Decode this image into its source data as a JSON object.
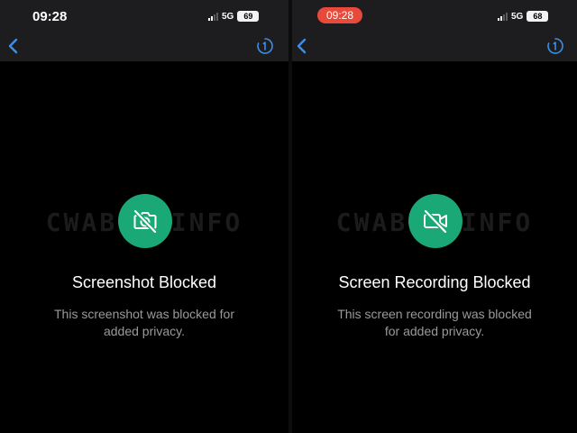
{
  "left": {
    "status": {
      "time": "09:28",
      "network": "5G",
      "battery": "69"
    },
    "watermark": "CWABETAINFO",
    "title": "Screenshot Blocked",
    "description": [
      "This screenshot was blocked for",
      "added privacy."
    ],
    "icons": {
      "back": "chevron-left-icon",
      "timer": "disappearing-timer-icon",
      "badge": "camera-off-icon"
    }
  },
  "right": {
    "status": {
      "time": "09:28",
      "network": "5G",
      "battery": "68"
    },
    "watermark": "CWABETAINFO",
    "title": "Screen Recording Blocked",
    "description": [
      "This screen recording was blocked",
      "for added privacy."
    ],
    "icons": {
      "back": "chevron-left-icon",
      "timer": "disappearing-timer-icon",
      "badge": "video-off-icon"
    }
  },
  "colors": {
    "accent": "#1aa876",
    "recording": "#e74a3b",
    "link": "#3b8fe8",
    "header": "#1d1d1f"
  }
}
